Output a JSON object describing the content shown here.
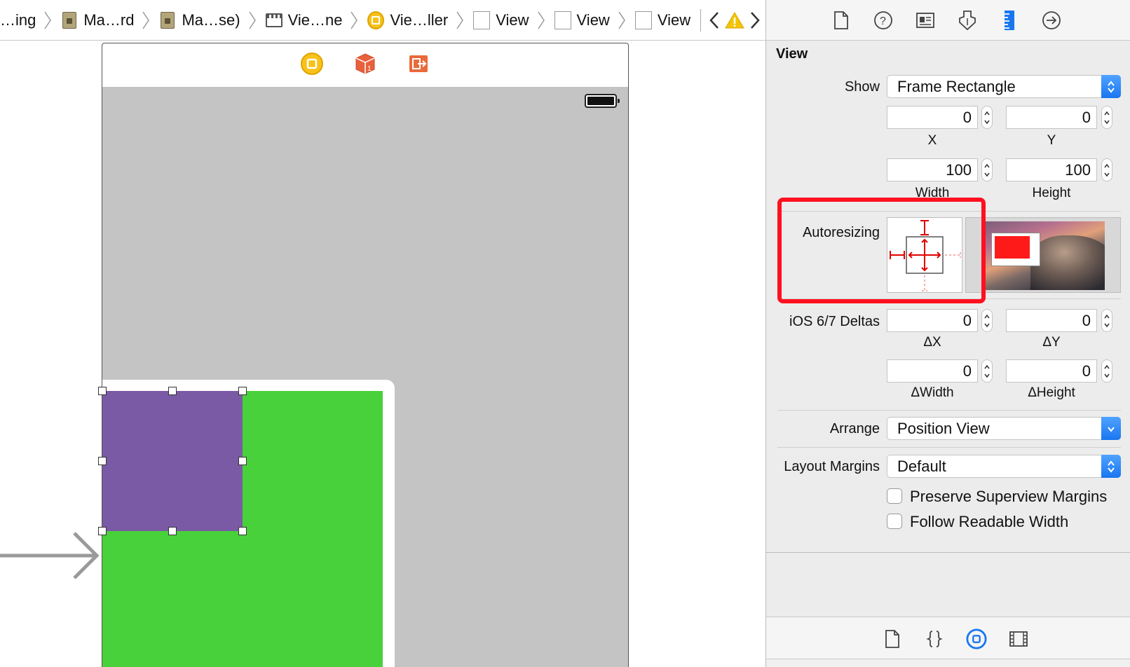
{
  "breadcrumb": {
    "items": [
      {
        "label": "…ing",
        "icon": "none"
      },
      {
        "label": "Ma…rd",
        "icon": "storyboard-file-icon"
      },
      {
        "label": "Ma…se)",
        "icon": "storyboard-file-icon"
      },
      {
        "label": "Vie…ne",
        "icon": "scene-icon"
      },
      {
        "label": "Vie…ller",
        "icon": "view-controller-icon"
      },
      {
        "label": "View",
        "icon": "view-icon"
      },
      {
        "label": "View",
        "icon": "view-icon"
      },
      {
        "label": "View",
        "icon": "view-icon"
      }
    ],
    "nav": {
      "back": "chevron-left-icon",
      "warning": "warning-icon",
      "forward": "chevron-right-icon"
    }
  },
  "inspector": {
    "tabs": [
      "file-inspector-icon",
      "quick-help-icon",
      "identity-inspector-icon",
      "attributes-inspector-icon",
      "size-inspector-icon",
      "connections-inspector-icon"
    ],
    "active_tab": "size-inspector-icon",
    "section_title": "View",
    "show": {
      "label": "Show",
      "value": "Frame Rectangle"
    },
    "x": {
      "value": "0",
      "label": "X"
    },
    "y": {
      "value": "0",
      "label": "Y"
    },
    "width": {
      "value": "100",
      "label": "Width"
    },
    "height": {
      "value": "100",
      "label": "Height"
    },
    "autoresizing": {
      "label": "Autoresizing"
    },
    "deltas": {
      "label": "iOS 6/7 Deltas",
      "dx": {
        "value": "0",
        "label": "ΔX"
      },
      "dy": {
        "value": "0",
        "label": "ΔY"
      },
      "dwidth": {
        "value": "0",
        "label": "ΔWidth"
      },
      "dheight": {
        "value": "0",
        "label": "ΔHeight"
      }
    },
    "arrange": {
      "label": "Arrange",
      "value": "Position View"
    },
    "layout_margins": {
      "label": "Layout Margins",
      "value": "Default"
    },
    "preserve_superview_margins": {
      "label": "Preserve Superview Margins",
      "checked": false
    },
    "follow_readable_width": {
      "label": "Follow Readable Width",
      "checked": false
    },
    "library_tabs": [
      "file-template-icon",
      "code-snippet-icon",
      "object-library-icon",
      "media-library-icon"
    ],
    "active_library_tab": "object-library-icon"
  },
  "canvas": {
    "scene_dock_icons": [
      "view-controller-icon",
      "first-responder-icon",
      "exit-icon"
    ],
    "colors": {
      "superview": "#48d13a",
      "selected_view": "#7a5aa5",
      "scene_background": "#c4c4c4",
      "highlight": "#ff1020"
    }
  }
}
